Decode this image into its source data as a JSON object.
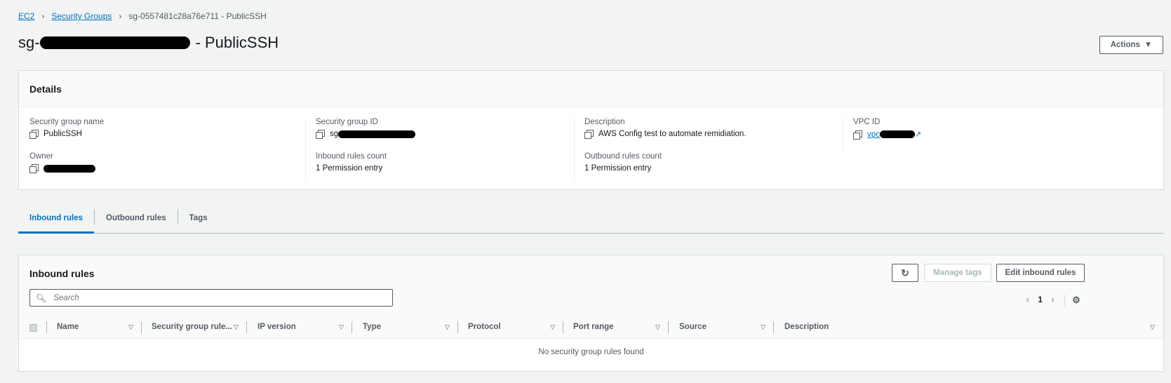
{
  "breadcrumb": {
    "ec2": "EC2",
    "security_groups": "Security Groups",
    "current": "sg-0557481c28a76e711 - PublicSSH"
  },
  "header": {
    "title_prefix": "sg-",
    "title_suffix": "- PublicSSH",
    "actions_label": "Actions"
  },
  "details": {
    "title": "Details",
    "sg_name_label": "Security group name",
    "sg_name_value": "PublicSSH",
    "sg_id_label": "Security group ID",
    "sg_id_prefix": "sg",
    "description_label": "Description",
    "description_value": "AWS Config test to automate remidiation.",
    "vpc_label": "VPC ID",
    "vpc_prefix": "vpc",
    "owner_label": "Owner",
    "inbound_count_label": "Inbound rules count",
    "inbound_count_value": "1 Permission entry",
    "outbound_count_label": "Outbound rules count",
    "outbound_count_value": "1 Permission entry"
  },
  "tabs": {
    "inbound": "Inbound rules",
    "outbound": "Outbound rules",
    "tags": "Tags"
  },
  "rules": {
    "title": "Inbound rules",
    "manage_tags": "Manage tags",
    "edit_inbound": "Edit inbound rules",
    "search_placeholder": "Search",
    "page": "1",
    "columns": [
      "Name",
      "Security group rule...",
      "IP version",
      "Type",
      "Protocol",
      "Port range",
      "Source",
      "Description"
    ],
    "empty_message": "No security group rules found"
  },
  "colors": {
    "accent": "#0073bb",
    "background": "#f2f3f3"
  }
}
